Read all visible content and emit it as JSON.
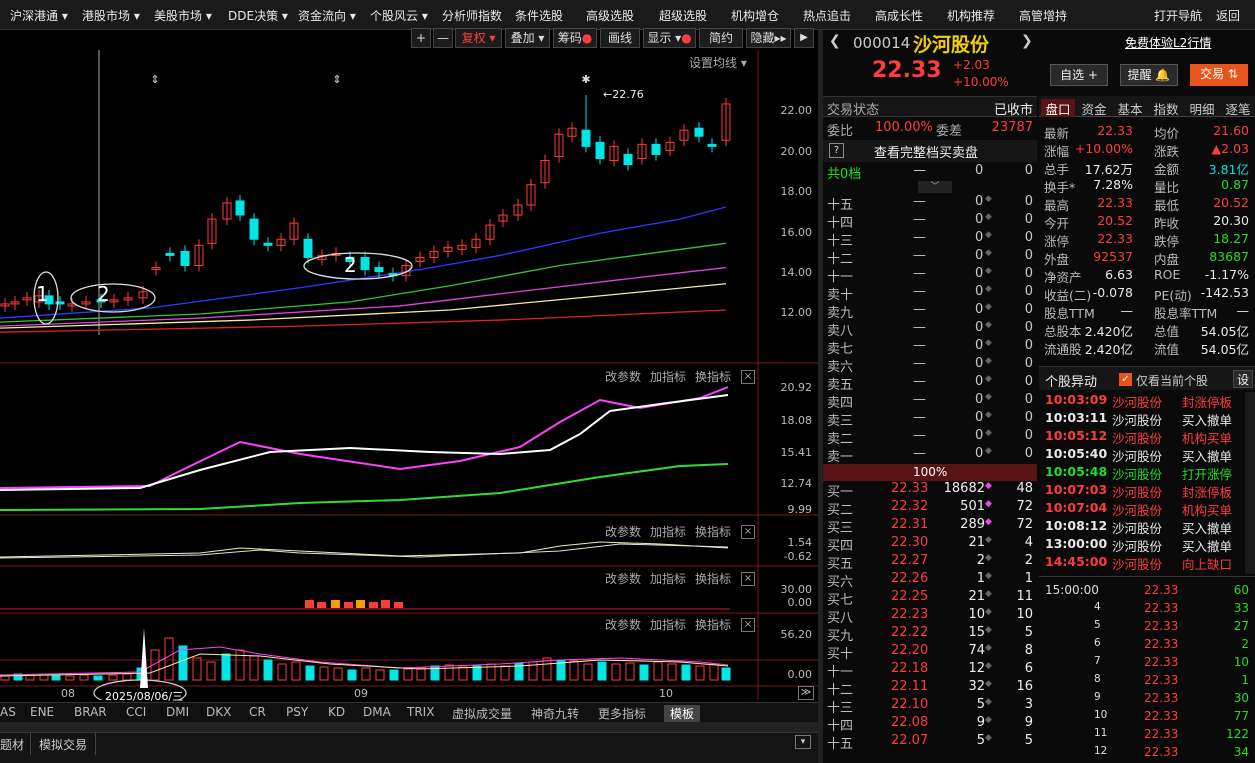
{
  "nav": {
    "items": [
      "沪深港通 ▾",
      "港股市场 ▾",
      "美股市场 ▾",
      "DDE决策 ▾",
      "资金流向 ▾",
      "个股风云 ▾",
      "分析师指数",
      "条件选股",
      "高级选股",
      "超级选股",
      "机构增仓",
      "热点追击",
      "高成长性",
      "机构推荐",
      "高管增持"
    ],
    "right": [
      "打开导航",
      "返回"
    ]
  },
  "toolbar": {
    "plus": "+",
    "minus": "—",
    "fuquan": "复权",
    "diejia": "叠加",
    "chouma": "筹码",
    "huaxian": "画线",
    "xianshi": "显示",
    "jianyue": "简约",
    "yincang": "隐藏",
    "expand": "▸▸"
  },
  "chart": {
    "setting_ma": "设置均线",
    "max_label": "22.76",
    "y_labels": [
      "22.00",
      "20.00",
      "18.00",
      "16.00",
      "14.00",
      "12.00"
    ],
    "circle_labels": [
      "1",
      "2",
      "2"
    ],
    "x_labels": [
      "08",
      "09",
      "10"
    ],
    "date_box": "2025/08/06/三",
    "panel_buttons": [
      "改参数",
      "加指标",
      "换指标"
    ],
    "close_icon": "×",
    "p2_labels": [
      "20.92",
      "18.08",
      "15.41",
      "12.74",
      "9.99"
    ],
    "p3_labels": [
      "1.54",
      "-0.62"
    ],
    "p4_labels": [
      "30.00",
      "0.00"
    ],
    "p5_labels": [
      "56.20",
      "0.00"
    ],
    "scroll_right": "≫",
    "indicator_tabs": [
      "AS",
      "ENE",
      "BRAR",
      "CCI",
      "DMI",
      "DKX",
      "CR",
      "PSY",
      "KD",
      "DMA",
      "TRIX",
      "虚拟成交量",
      "神奇九转",
      "更多指标",
      "模板"
    ],
    "bottom_tabs": [
      "题材",
      "模拟交易"
    ]
  },
  "stock": {
    "code": "000014",
    "name": "沙河股份",
    "price": "22.33",
    "change": "+2.03",
    "pct": "+10.00%",
    "free_l2": "免费体验L2行情",
    "zixuan": "自选 +",
    "tixing": "提醒 🔔",
    "jiaoyi": "交易 ⇅",
    "trade_status_label": "交易状态",
    "trade_status": "已收市",
    "weibi_label": "委比",
    "weibi": "100.00%",
    "weicha_label": "委差",
    "weicha": "23787",
    "view_full": "查看完整档买卖盘",
    "help": "?",
    "gong": "共0档",
    "pct_bar": "100%"
  },
  "sell_rows": [
    {
      "l": "十五",
      "p": "—",
      "v": "0",
      "n": "0"
    },
    {
      "l": "十四",
      "p": "—",
      "v": "0",
      "n": "0"
    },
    {
      "l": "十三",
      "p": "—",
      "v": "0",
      "n": "0"
    },
    {
      "l": "十二",
      "p": "—",
      "v": "0",
      "n": "0"
    },
    {
      "l": "十一",
      "p": "—",
      "v": "0",
      "n": "0"
    },
    {
      "l": "卖十",
      "p": "—",
      "v": "0",
      "n": "0"
    },
    {
      "l": "卖九",
      "p": "—",
      "v": "0",
      "n": "0"
    },
    {
      "l": "卖八",
      "p": "—",
      "v": "0",
      "n": "0"
    },
    {
      "l": "卖七",
      "p": "—",
      "v": "0",
      "n": "0"
    },
    {
      "l": "卖六",
      "p": "—",
      "v": "0",
      "n": "0"
    },
    {
      "l": "卖五",
      "p": "—",
      "v": "0",
      "n": "0"
    },
    {
      "l": "卖四",
      "p": "—",
      "v": "0",
      "n": "0"
    },
    {
      "l": "卖三",
      "p": "—",
      "v": "0",
      "n": "0"
    },
    {
      "l": "卖二",
      "p": "—",
      "v": "0",
      "n": "0"
    },
    {
      "l": "卖一",
      "p": "—",
      "v": "0",
      "n": "0"
    }
  ],
  "buy_rows": [
    {
      "l": "买一",
      "p": "22.33",
      "v": "18682",
      "n": "48"
    },
    {
      "l": "买二",
      "p": "22.32",
      "v": "501",
      "n": "72"
    },
    {
      "l": "买三",
      "p": "22.31",
      "v": "289",
      "n": "72"
    },
    {
      "l": "买四",
      "p": "22.30",
      "v": "21",
      "n": "4"
    },
    {
      "l": "买五",
      "p": "22.27",
      "v": "2",
      "n": "2"
    },
    {
      "l": "买六",
      "p": "22.26",
      "v": "1",
      "n": "1"
    },
    {
      "l": "买七",
      "p": "22.25",
      "v": "21",
      "n": "11"
    },
    {
      "l": "买八",
      "p": "22.23",
      "v": "10",
      "n": "10"
    },
    {
      "l": "买九",
      "p": "22.22",
      "v": "15",
      "n": "5"
    },
    {
      "l": "买十",
      "p": "22.20",
      "v": "74",
      "n": "8"
    },
    {
      "l": "十一",
      "p": "22.18",
      "v": "12",
      "n": "6"
    },
    {
      "l": "十二",
      "p": "22.11",
      "v": "32",
      "n": "16"
    },
    {
      "l": "十三",
      "p": "22.10",
      "v": "5",
      "n": "3"
    },
    {
      "l": "十四",
      "p": "22.08",
      "v": "9",
      "n": "9"
    },
    {
      "l": "十五",
      "p": "22.07",
      "v": "5",
      "n": "5"
    }
  ],
  "tabs": [
    "盘口",
    "资金",
    "基本",
    "指数",
    "明细",
    "逐笔"
  ],
  "quote": [
    {
      "a": "最新",
      "av": "22.33",
      "ac": "red",
      "b": "均价",
      "bv": "21.60",
      "bc": "red"
    },
    {
      "a": "涨幅",
      "av": "+10.00%",
      "ac": "red",
      "b": "涨跌",
      "bv": "▲2.03",
      "bc": "red"
    },
    {
      "a": "总手",
      "av": "17.62万",
      "ac": "wht",
      "b": "金额",
      "bv": "3.81亿",
      "bc": "cyn"
    },
    {
      "a": "换手*",
      "av": "7.28%",
      "ac": "wht",
      "b": "量比",
      "bv": "0.87",
      "bc": "grn"
    },
    {
      "a": "最高",
      "av": "22.33",
      "ac": "red",
      "b": "最低",
      "bv": "20.52",
      "bc": "red"
    },
    {
      "a": "今开",
      "av": "20.52",
      "ac": "red",
      "b": "昨收",
      "bv": "20.30",
      "bc": "wht"
    },
    {
      "a": "涨停",
      "av": "22.33",
      "ac": "red",
      "b": "跌停",
      "bv": "18.27",
      "bc": "grn"
    },
    {
      "a": "外盘",
      "av": "92537",
      "ac": "red",
      "b": "内盘",
      "bv": "83687",
      "bc": "grn"
    },
    {
      "a": "净资产",
      "av": "6.63",
      "ac": "wht",
      "b": "ROE",
      "bv": "-1.17%",
      "bc": "wht"
    },
    {
      "a": "收益(二)",
      "av": "-0.078",
      "ac": "wht",
      "b": "PE(动)",
      "bv": "-142.53",
      "bc": "wht"
    },
    {
      "a": "股息TTM",
      "av": "—",
      "ac": "wht",
      "b": "股息率TTM",
      "bv": "—",
      "bc": "wht"
    },
    {
      "a": "总股本",
      "av": "2.420亿",
      "ac": "wht",
      "b": "总值",
      "bv": "54.05亿",
      "bc": "wht"
    },
    {
      "a": "流通股",
      "av": "2.420亿",
      "ac": "wht",
      "b": "流值",
      "bv": "54.05亿",
      "bc": "wht"
    }
  ],
  "alerts": {
    "title": "个股异动",
    "checkbox": "仅看当前个股",
    "settings": "设",
    "rows": [
      {
        "t": "10:03:09",
        "n": "沙河股份",
        "e": "封涨停板",
        "c": "red"
      },
      {
        "t": "10:03:11",
        "n": "沙河股份",
        "e": "买入撤单",
        "c": "wht"
      },
      {
        "t": "10:05:12",
        "n": "沙河股份",
        "e": "机构买单",
        "c": "red"
      },
      {
        "t": "10:05:40",
        "n": "沙河股份",
        "e": "买入撤单",
        "c": "wht"
      },
      {
        "t": "10:05:48",
        "n": "沙河股份",
        "e": "打开涨停",
        "c": "grn"
      },
      {
        "t": "10:07:03",
        "n": "沙河股份",
        "e": "封涨停板",
        "c": "red"
      },
      {
        "t": "10:07:04",
        "n": "沙河股份",
        "e": "机构买单",
        "c": "red"
      },
      {
        "t": "10:08:12",
        "n": "沙河股份",
        "e": "买入撤单",
        "c": "wht"
      },
      {
        "t": "13:00:00",
        "n": "沙河股份",
        "e": "买入撤单",
        "c": "wht"
      },
      {
        "t": "14:45:00",
        "n": "沙河股份",
        "e": "向上缺口",
        "c": "red"
      }
    ]
  },
  "ticks": [
    {
      "t": "15:00:00",
      "p": "22.33",
      "v": "60"
    },
    {
      "t": "4",
      "p": "22.33",
      "v": "33"
    },
    {
      "t": "5",
      "p": "22.33",
      "v": "27"
    },
    {
      "t": "6",
      "p": "22.33",
      "v": "2"
    },
    {
      "t": "7",
      "p": "22.33",
      "v": "10"
    },
    {
      "t": "8",
      "p": "22.33",
      "v": "1"
    },
    {
      "t": "9",
      "p": "22.33",
      "v": "30"
    },
    {
      "t": "10",
      "p": "22.33",
      "v": "77"
    },
    {
      "t": "11",
      "p": "22.33",
      "v": "122"
    },
    {
      "t": "12",
      "p": "22.33",
      "v": "34"
    }
  ]
}
